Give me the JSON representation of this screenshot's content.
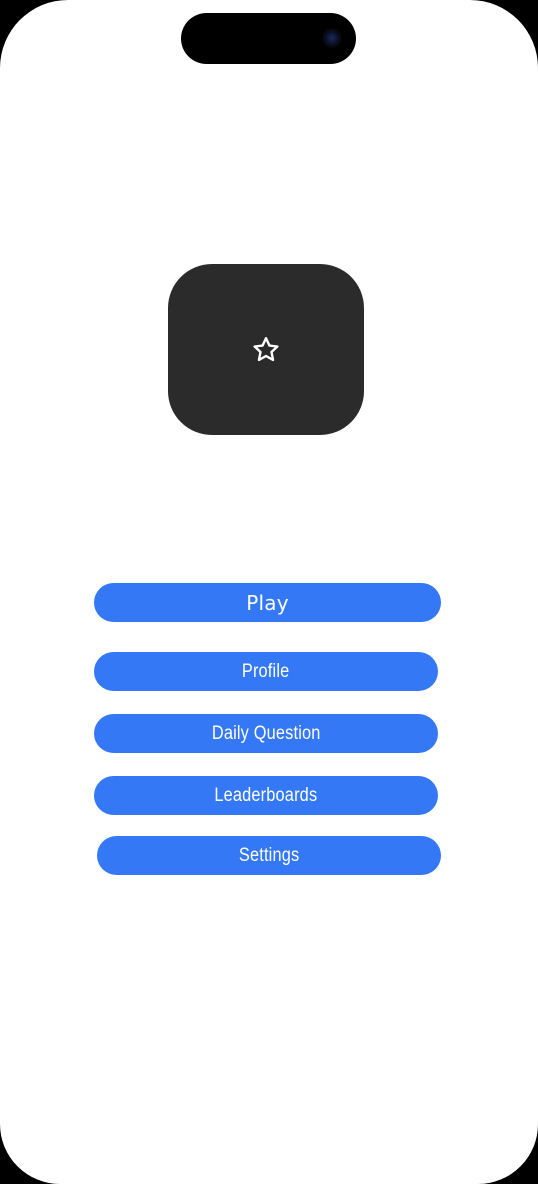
{
  "logo": {
    "icon": "star-outline-icon",
    "tile_color": "#2b2b2b"
  },
  "menu": {
    "accent_color": "#3478f6",
    "buttons": [
      {
        "id": "play",
        "label": "Play"
      },
      {
        "id": "profile",
        "label": "Profile"
      },
      {
        "id": "daily_question",
        "label": "Daily Question"
      },
      {
        "id": "leaderboards",
        "label": "Leaderboards"
      },
      {
        "id": "settings",
        "label": "Settings"
      }
    ]
  }
}
